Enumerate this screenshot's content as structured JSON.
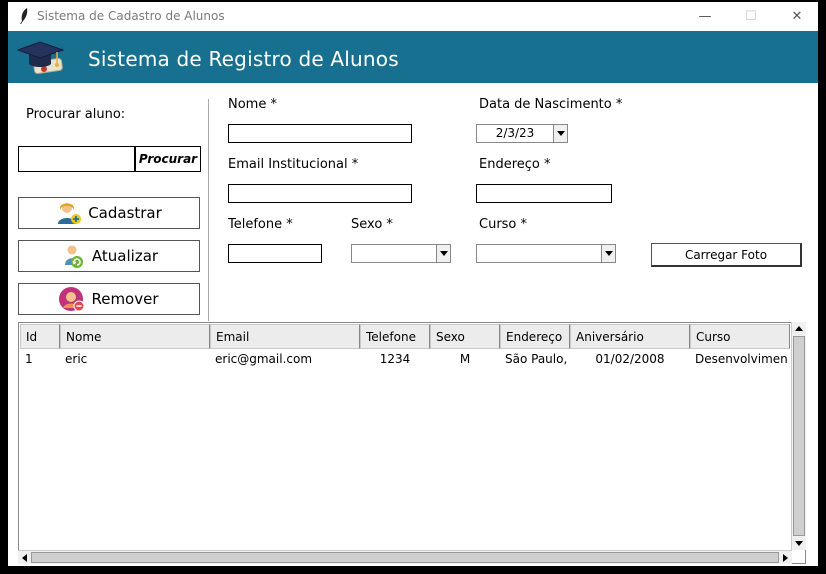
{
  "window": {
    "title": "Sistema de Cadastro de Alunos",
    "minimize_glyph": "—",
    "maximize_glyph": "☐",
    "close_glyph": "✕"
  },
  "header": {
    "title": "Sistema de Registro de Alunos",
    "icon": "graduation-cap-icon",
    "bg_color": "#17708f"
  },
  "search": {
    "label": "Procurar aluno:",
    "value": "",
    "button_label": "Procurar"
  },
  "actions": {
    "register_label": "Cadastrar",
    "update_label": "Atualizar",
    "remove_label": "Remover"
  },
  "form": {
    "name_label": "Nome *",
    "name_value": "",
    "email_label": "Email Institucional *",
    "email_value": "",
    "phone_label": "Telefone *",
    "phone_value": "",
    "gender_label": "Sexo *",
    "gender_value": "",
    "birth_label": "Data de Nascimento *",
    "birth_value": "2/3/23",
    "address_label": "Endereço *",
    "address_value": "",
    "course_label": "Curso *",
    "course_value": "",
    "photo_button_label": "Carregar Foto"
  },
  "table": {
    "columns": [
      "Id",
      "Nome",
      "Email",
      "Telefone",
      "Sexo",
      "Endereço",
      "Aniversário",
      "Curso"
    ],
    "rows": [
      [
        "1",
        "eric",
        "eric@gmail.com",
        "1234",
        "M",
        "São Paulo, C",
        "01/02/2008",
        "Desenvolvimento"
      ]
    ]
  }
}
